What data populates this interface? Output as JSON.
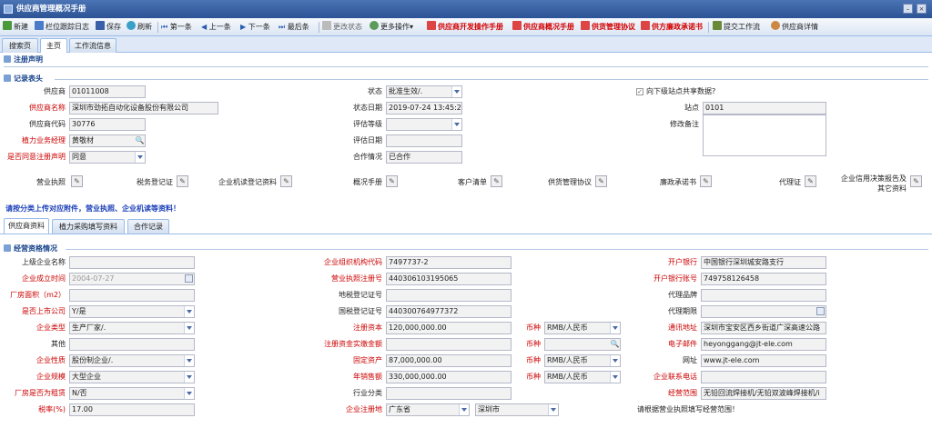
{
  "window": {
    "title": "供应商管理概况手册"
  },
  "toolbar": {
    "new": "新建",
    "log": "栏位跟踪日志",
    "save": "保存",
    "refresh": "刷新",
    "first": "第一条",
    "prev": "上一条",
    "next": "下一条",
    "last": "最后条",
    "change_status": "更改状态",
    "more": "更多操作",
    "dev_manual": "供应商开发操作手册",
    "overview_manual": "供应商概况手册",
    "supply_agreement": "供货管理协议",
    "integrity": "供方廉政承诺书",
    "submit": "提交工作流",
    "detail": "供应商详情"
  },
  "top_tabs": [
    "搜索页",
    "主页",
    "工作流信息"
  ],
  "sections": {
    "reg": "注册声明",
    "record": "记录表头",
    "qual": "经营资格情况"
  },
  "record": {
    "supplier_no": {
      "label": "供应商",
      "value": "01011008"
    },
    "supplier_name": {
      "label": "供应商名称",
      "value": "深圳市劲拓自动化设备股份有限公司"
    },
    "supplier_code": {
      "label": "供应商代码",
      "value": "30776"
    },
    "manager": {
      "label": "植力业务经理",
      "value": "黄敬材"
    },
    "agree": {
      "label": "是否同意注册声明",
      "value": "同意"
    },
    "status": {
      "label": "状态",
      "value": "批准生效/."
    },
    "status_date": {
      "label": "状态日期",
      "value": "2019-07-24 13:45:23"
    },
    "eval_level": {
      "label": "评估等级",
      "value": ""
    },
    "eval_date": {
      "label": "评估日期",
      "value": ""
    },
    "coop": {
      "label": "合作情况",
      "value": "已合作"
    },
    "share": {
      "label": "向下级站点共享数据?"
    },
    "site": {
      "label": "站点",
      "value": "0101"
    },
    "remark": {
      "label": "修改备注"
    }
  },
  "attachments": [
    "营业执照",
    "税务登记证",
    "企业机读登记资料",
    "概况手册",
    "客户清单",
    "供货管理协议",
    "廉政承诺书",
    "代理证",
    "企业信用决策报告及其它资料"
  ],
  "notice": "请按分类上传对应附件，营业执照、企业机读等资料！",
  "sub_tabs": [
    "供应商资料",
    "植力采购填写资料",
    "合作记录"
  ],
  "qual": {
    "parent": {
      "label": "上级企业名称",
      "value": ""
    },
    "found": {
      "label": "企业成立时间",
      "value": "2004-07-27"
    },
    "area": {
      "label": "厂房面积（m2）",
      "value": ""
    },
    "listed": {
      "label": "是否上市公司",
      "value": "Y/是"
    },
    "type": {
      "label": "企业类型",
      "value": "生产厂家/."
    },
    "other": {
      "label": "其他",
      "value": ""
    },
    "nature": {
      "label": "企业性质",
      "value": "股份制企业/."
    },
    "scale": {
      "label": "企业规模",
      "value": "大型企业"
    },
    "rent": {
      "label": "厂房是否为租赁",
      "value": "N/否"
    },
    "tax": {
      "label": "税率(%)",
      "value": "17.00"
    },
    "org_code": {
      "label": "企业组织机构代码",
      "value": "7497737-2"
    },
    "biz_reg": {
      "label": "营业执照注册号",
      "value": "440306103195065"
    },
    "local_tax": {
      "label": "地税登记证号",
      "value": ""
    },
    "nat_tax": {
      "label": "国税登记证号",
      "value": "440300764977372"
    },
    "capital": {
      "label": "注册资本",
      "value": "120,000,000.00"
    },
    "paid": {
      "label": "注册资金实缴金额",
      "value": ""
    },
    "fixed": {
      "label": "固定资产",
      "value": "87,000,000.00"
    },
    "sales": {
      "label": "年销售额",
      "value": "330,000,000.00"
    },
    "industry": {
      "label": "行业分类",
      "value": ""
    },
    "reg_addr": {
      "label": "企业注册地",
      "province": "广东省",
      "city": "深圳市"
    },
    "cur1": {
      "label": "币种",
      "value": "RMB/人民币"
    },
    "cur2": {
      "label": "币种",
      "value": ""
    },
    "cur3": {
      "label": "币种",
      "value": "RMB/人民币"
    },
    "cur4": {
      "label": "币种",
      "value": "RMB/人民币"
    },
    "bank": {
      "label": "开户银行",
      "value": "中国银行深圳城安路支行"
    },
    "account": {
      "label": "开户银行账号",
      "value": "749758126458"
    },
    "brand": {
      "label": "代理品牌",
      "value": ""
    },
    "term": {
      "label": "代理期限",
      "value": ""
    },
    "addr": {
      "label": "通讯地址",
      "value": "深圳市宝安区西乡街道广深高速公路"
    },
    "email": {
      "label": "电子邮件",
      "value": "heyonggang@jt-ele.com"
    },
    "web": {
      "label": "网址",
      "value": "www.jt-ele.com"
    },
    "phone": {
      "label": "企业联系电话",
      "value": ""
    },
    "scope": {
      "label": "经营范围",
      "value": "无铅回流焊接机/无铅双波峰焊接机/i"
    },
    "scope_note": "请根据营业执照填写经营范围！"
  }
}
